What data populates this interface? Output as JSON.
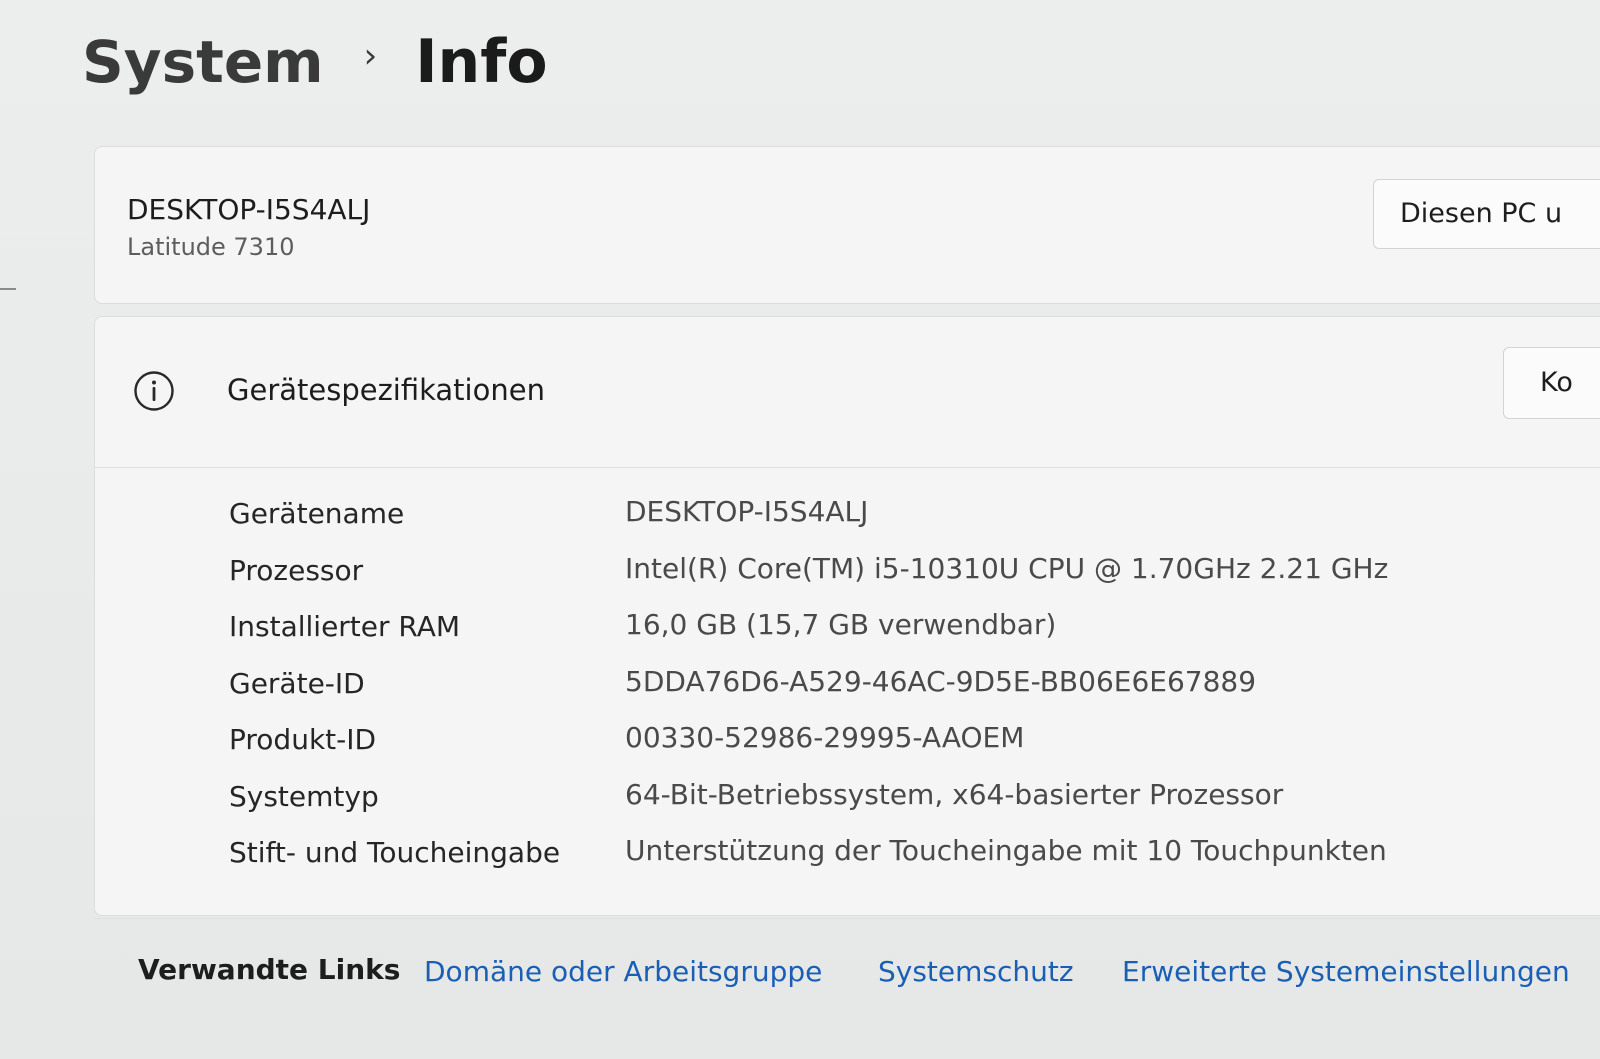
{
  "breadcrumb": {
    "parent": "System",
    "separator": "›",
    "current": "Info"
  },
  "device": {
    "name": "DESKTOP-I5S4ALJ",
    "model": "Latitude 7310",
    "rename_button_label": "Diesen PC u"
  },
  "specifications": {
    "icon": "info-icon",
    "title": "Gerätespezifikationen",
    "copy_button_label": "Ko",
    "rows": [
      {
        "label": "Gerätename",
        "value": "DESKTOP-I5S4ALJ"
      },
      {
        "label": "Prozessor",
        "value": "Intel(R) Core(TM) i5-10310U CPU @ 1.70GHz   2.21 GHz"
      },
      {
        "label": "Installierter RAM",
        "value": "16,0 GB (15,7 GB verwendbar)"
      },
      {
        "label": "Geräte-ID",
        "value": "5DDA76D6-A529-46AC-9D5E-BB06E6E67889"
      },
      {
        "label": "Produkt-ID",
        "value": "00330-52986-29995-AAOEM"
      },
      {
        "label": "Systemtyp",
        "value": "64-Bit-Betriebssystem, x64-basierter Prozessor"
      },
      {
        "label": "Stift- und Toucheingabe",
        "value": "Unterstützung der Toucheingabe mit 10 Touchpunkten"
      }
    ]
  },
  "related_links": {
    "label": "Verwandte Links",
    "links": [
      {
        "label": "Domäne oder Arbeitsgruppe"
      },
      {
        "label": "Systemschutz"
      },
      {
        "label": "Erweiterte Systemeinstellungen"
      }
    ]
  },
  "colors": {
    "link": "#1a5fb4",
    "card_background": "#f5f5f5",
    "page_background": "#e9ebeb"
  }
}
